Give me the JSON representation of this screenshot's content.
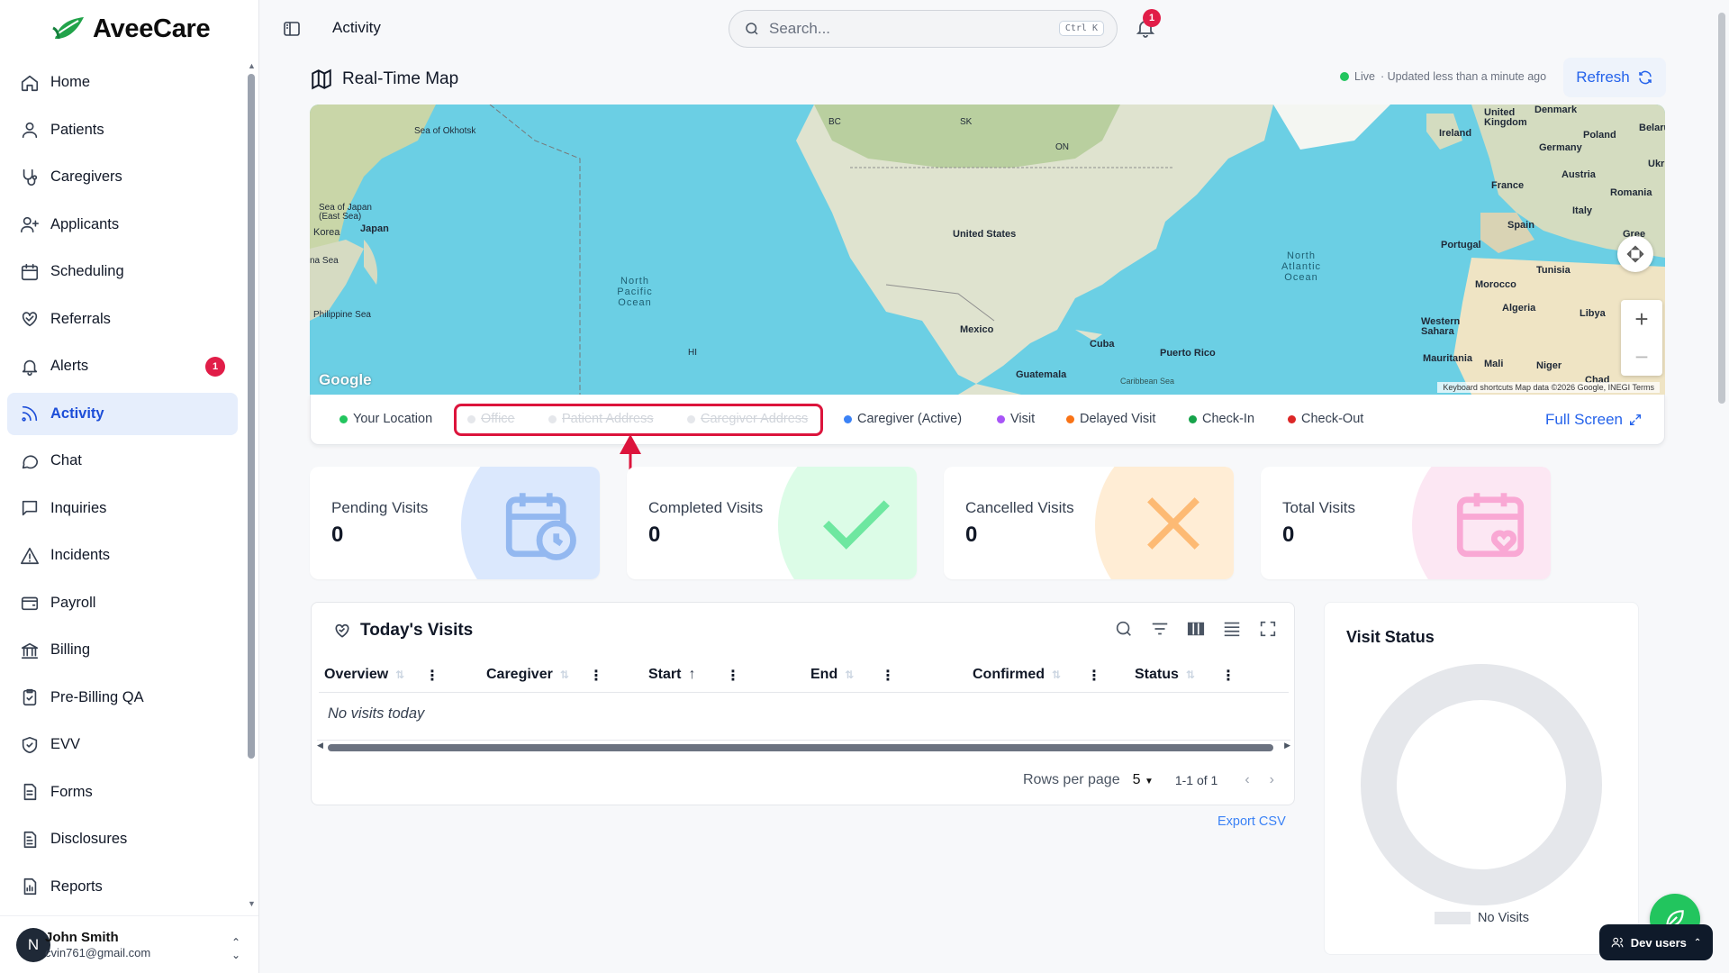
{
  "brand": {
    "name": "AveeCare"
  },
  "sidebar": {
    "items": [
      {
        "label": "Home",
        "icon": "home-icon"
      },
      {
        "label": "Patients",
        "icon": "user-icon"
      },
      {
        "label": "Caregivers",
        "icon": "stethoscope-icon"
      },
      {
        "label": "Applicants",
        "icon": "user-plus-icon"
      },
      {
        "label": "Scheduling",
        "icon": "calendar-icon"
      },
      {
        "label": "Referrals",
        "icon": "handshake-icon"
      },
      {
        "label": "Alerts",
        "icon": "bell-icon",
        "badge": "1"
      },
      {
        "label": "Activity",
        "icon": "activity-icon",
        "active": true
      },
      {
        "label": "Chat",
        "icon": "chat-icon"
      },
      {
        "label": "Inquiries",
        "icon": "message-square-icon"
      },
      {
        "label": "Incidents",
        "icon": "alert-triangle-icon"
      },
      {
        "label": "Payroll",
        "icon": "wallet-icon"
      },
      {
        "label": "Billing",
        "icon": "bank-icon"
      },
      {
        "label": "Pre-Billing QA",
        "icon": "clipboard-check-icon"
      },
      {
        "label": "EVV",
        "icon": "shield-check-icon"
      },
      {
        "label": "Forms",
        "icon": "file-text-icon"
      },
      {
        "label": "Disclosures",
        "icon": "file-icon"
      },
      {
        "label": "Reports",
        "icon": "bar-chart-file-icon"
      }
    ],
    "user": {
      "initial": "N",
      "name": "John Smith",
      "email": "cvin761@gmail.com"
    }
  },
  "topbar": {
    "title": "Activity",
    "search_placeholder": "Search...",
    "shortcut": "Ctrl K",
    "notifications": "1"
  },
  "map": {
    "title": "Real-Time Map",
    "live_label": "Live",
    "updated": "· Updated less than a minute ago",
    "refresh_label": "Refresh",
    "labels": {
      "sea_okhotsk": "Sea of Okhotsk",
      "sea_japan": "Sea of Japan (East Sea)",
      "korea": "Korea",
      "japan": "Japan",
      "china_sea": "na Sea",
      "philippine_sea": "Philippine Sea",
      "north_pacific": "North Pacific Ocean",
      "united_states": "United States",
      "mexico": "Mexico",
      "cuba": "Cuba",
      "puerto_rico": "Puerto Rico",
      "guatemala": "Guatemala",
      "caribbean": "Caribbean Sea",
      "north_atlantic": "North Atlantic Ocean",
      "ireland": "Ireland",
      "uk": "United Kingdom",
      "denmark": "Denmark",
      "germany": "Germany",
      "poland": "Poland",
      "france": "France",
      "austria": "Austria",
      "romania": "Romania",
      "italy": "Italy",
      "spain": "Spain",
      "portugal": "Portugal",
      "tunisia": "Tunisia",
      "morocco": "Morocco",
      "algeria": "Algeria",
      "libya": "Libya",
      "western_sahara": "Western Sahara",
      "mauritania": "Mauritania",
      "mali": "Mali",
      "niger": "Niger",
      "chad": "Chad",
      "belarus": "Belaru",
      "ukr": "Ukr",
      "gree": "Gree",
      "hi": "HI",
      "bc": "BC",
      "sk": "SK",
      "on": "ON"
    },
    "google": "Google",
    "attribution": "Keyboard shortcuts   Map data ©2026 Google, INEGI   Terms"
  },
  "legend": {
    "items": [
      {
        "label": "Your Location",
        "color": "#22c55e",
        "enabled": true
      },
      {
        "label": "Office",
        "color": "#e5e7eb",
        "enabled": false
      },
      {
        "label": "Patient Address",
        "color": "#e5e7eb",
        "enabled": false
      },
      {
        "label": "Caregiver Address",
        "color": "#e5e7eb",
        "enabled": false
      },
      {
        "label": "Caregiver (Active)",
        "color": "#3b82f6",
        "enabled": true
      },
      {
        "label": "Visit",
        "color": "#a855f7",
        "enabled": true
      },
      {
        "label": "Delayed Visit",
        "color": "#f97316",
        "enabled": true
      },
      {
        "label": "Check-In",
        "color": "#16a34a",
        "enabled": true
      },
      {
        "label": "Check-Out",
        "color": "#dc2626",
        "enabled": true
      }
    ],
    "fullscreen_label": "Full Screen"
  },
  "stats": [
    {
      "label": "Pending Visits",
      "value": "0",
      "color": "#dbe8fd",
      "icon": "calendar-clock-icon"
    },
    {
      "label": "Completed Visits",
      "value": "0",
      "color": "#dcfce7",
      "icon": "check-icon"
    },
    {
      "label": "Cancelled Visits",
      "value": "0",
      "color": "#ffedd5",
      "icon": "x-icon"
    },
    {
      "label": "Total Visits",
      "value": "0",
      "color": "#fce7f3",
      "icon": "calendar-heart-icon"
    }
  ],
  "visits": {
    "title": "Today's Visits",
    "columns": [
      "Overview",
      "Caregiver",
      "Start",
      "End",
      "Confirmed",
      "Status"
    ],
    "empty": "No visits today",
    "rows_per_page_label": "Rows per page",
    "rows_per_page": "5",
    "range": "1-1 of 1",
    "export": "Export CSV"
  },
  "visit_status": {
    "title": "Visit Status",
    "legend": "No Visits"
  },
  "dev_users": "Dev users"
}
